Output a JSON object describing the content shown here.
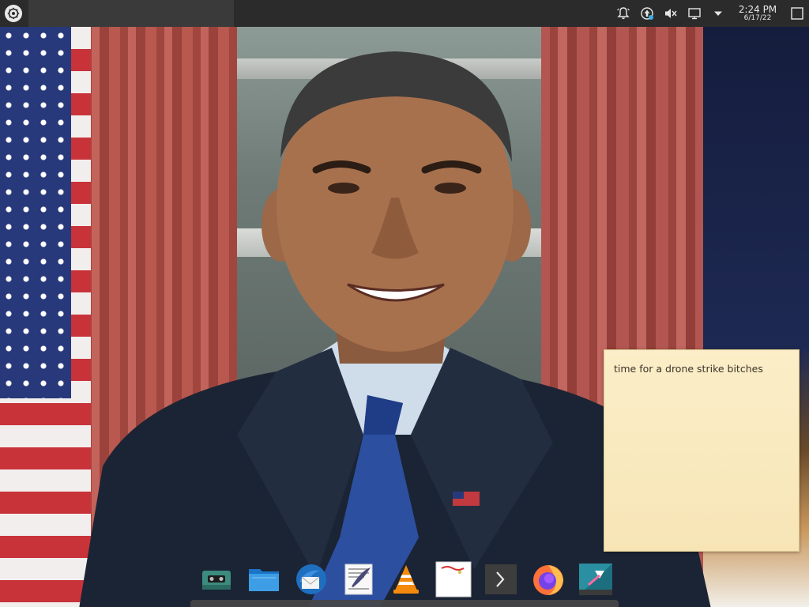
{
  "panel": {
    "launcher_icon": "kde-launcher-icon",
    "tray_icons": [
      "notifications-bell-icon",
      "updates-icon",
      "volume-muted-icon",
      "display-icon",
      "expand-tray-icon"
    ],
    "clock": {
      "time": "2:24 PM",
      "date": "6/17/22"
    },
    "show_desktop_icon": "show-desktop-icon"
  },
  "sticky_note": {
    "text": "time for a drone strike bitches",
    "color": "#f9eac0"
  },
  "dock": {
    "items": [
      {
        "name": "tape-recorder-icon"
      },
      {
        "name": "file-manager-icon"
      },
      {
        "name": "mail-client-icon"
      },
      {
        "name": "text-editor-icon"
      },
      {
        "name": "vlc-icon"
      },
      {
        "name": "notes-app-icon"
      },
      {
        "name": "terminal-icon"
      },
      {
        "name": "firefox-icon"
      },
      {
        "name": "kdenlive-icon"
      }
    ]
  }
}
